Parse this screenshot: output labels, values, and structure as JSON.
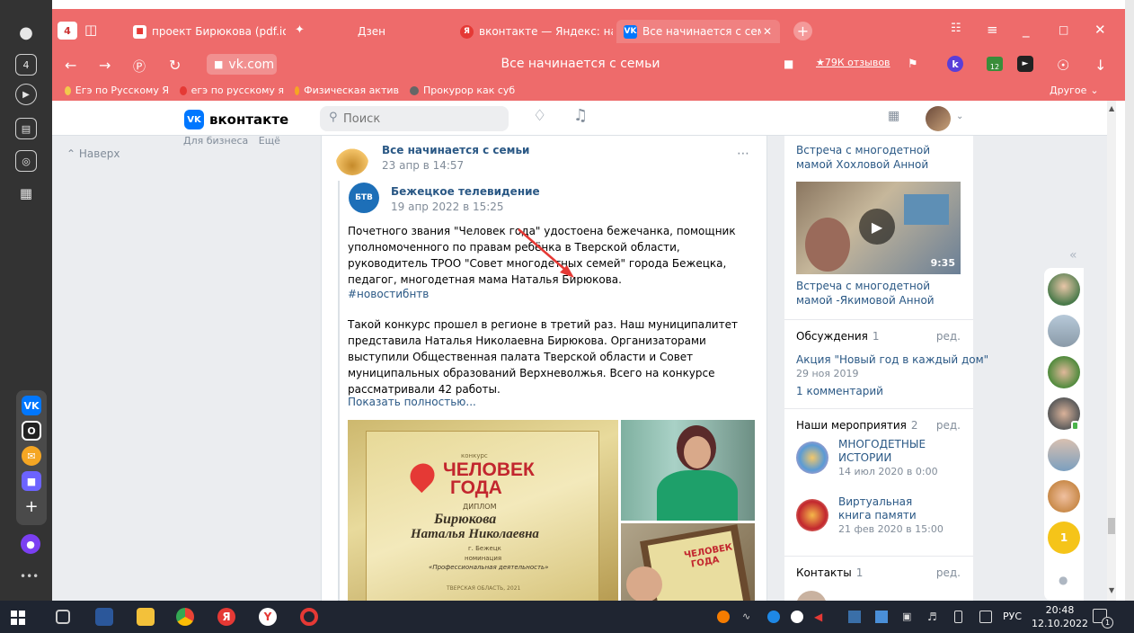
{
  "browser": {
    "tab_count": "4",
    "tabs": [
      {
        "label": "проект Бирюкова (pdf.io)",
        "fav_color": "#e53935"
      },
      {
        "label": "Дзен",
        "fav_color": "#000000"
      },
      {
        "label": "вконтакте — Яндекс: наш",
        "fav_color": "#e53935"
      },
      {
        "label": "Все начинается с семьи",
        "fav_color": "#0077ff",
        "active": true
      }
    ],
    "url": "vk.com",
    "page_title": "Все начинается с семьи",
    "reviews": "★79К отзывов",
    "badge_12": "12",
    "bookmarks": [
      {
        "label": "Егэ по Русскому Я",
        "color": "#f2c94c"
      },
      {
        "label": "егэ по русскому я",
        "color": "#e53935"
      },
      {
        "label": "Физическая актив",
        "color": "#f5a623"
      },
      {
        "label": "Прокурор как суб",
        "color": "#666666"
      }
    ],
    "bookmarks_other": "Другое"
  },
  "vk": {
    "logo_text": "вконтакте",
    "logo_mark": "VK",
    "search_placeholder": "Поиск",
    "left": {
      "for_business": "Для бизнеса",
      "more": "Ещё",
      "back_to_top": "Наверх"
    },
    "post": {
      "author": "Все начинается с семьи",
      "date": "23 апр в 14:57",
      "repost": {
        "author": "Бежецкое телевидение",
        "logo_text": "БТВ",
        "date": "19 апр 2022 в 15:25",
        "paragraph1": "Почетного звания \"Человек года\" удостоена бежечанка, помощник уполномоченного по правам ребёнка в Тверской области, руководитель ТРОО \"Совет многодетных семей\" города Бежецка, педагог, многодетная мама Наталья Бирюкова.",
        "hashtag": "#новостибнтв",
        "paragraph2": "Такой конкурс прошел в регионе в третий раз. Наш муниципалитет представила Наталья Николаевна Бирюкова. Организаторами выступили Общественная палата Тверской области и Совет муниципальных образований Верхневолжья. Всего на конкурсе рассматривали 42 работы.",
        "show_more": "Показать полностью...",
        "diploma": {
          "top": "конкурс",
          "title1": "ЧЕЛОВЕК",
          "title2": "ГОДА",
          "subtitle": "диплом",
          "surname": "Бирюкова",
          "name": "Наталья Николаевна",
          "city": "г. Бежецк",
          "nomination_label": "номинация",
          "nomination": "«Профессиональная деятельность»",
          "footer": "ТВЕРСКАЯ ОБЛАСТЬ, 2021"
        },
        "small_diploma": {
          "title1": "ЧЕЛОВЕК",
          "title2": "ГОДА"
        }
      }
    },
    "right": {
      "video1_caption": "Встреча с многодетной мамой Хохловой Анной",
      "video2_duration": "9:35",
      "video2_caption": "Встреча с многодетной мамой -Якимовой Анной",
      "discussions": {
        "title": "Обсуждения",
        "count": "1",
        "edit": "ред.",
        "topic": "Акция \"Новый год в каждый дом\"",
        "date": "29 ноя 2019",
        "comments": "1 комментарий"
      },
      "events": {
        "title": "Наши мероприятия",
        "count": "2",
        "edit": "ред.",
        "items": [
          {
            "name": "МНОГОДЕТНЫЕ ИСТОРИИ",
            "date": "14 июл 2020 в 0:00"
          },
          {
            "name": "Виртуальная книга памяти",
            "date": "21 фев 2020 в 15:00"
          }
        ]
      },
      "contacts": {
        "title": "Контакты",
        "count": "1",
        "edit": "ред."
      }
    },
    "friends_badge": "1"
  },
  "taskbar": {
    "lang": "РУС",
    "time": "20:48",
    "date": "12.10.2022",
    "notif": "1"
  }
}
